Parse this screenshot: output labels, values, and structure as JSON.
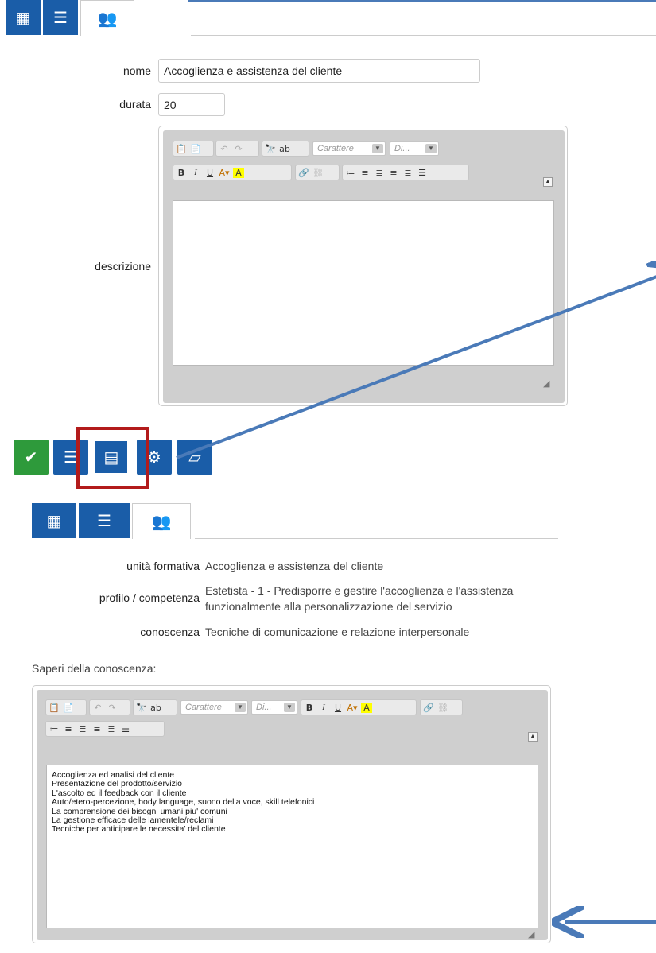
{
  "top": {
    "tabs": [
      {
        "icon": "calendar-icon",
        "glyph": "▦"
      },
      {
        "icon": "list-icon",
        "glyph": "☰"
      },
      {
        "icon": "users-icon",
        "glyph": "👥"
      }
    ],
    "form": {
      "name_label": "nome",
      "name_value": "Accoglienza e assistenza del cliente",
      "duration_label": "durata",
      "duration_value": "20",
      "description_label": "descrizione",
      "font_combo": "Carattere",
      "size_combo": "Di..."
    },
    "actions": [
      {
        "icon": "check-icon",
        "glyph": "✔"
      },
      {
        "icon": "list-icon",
        "glyph": "☰"
      },
      {
        "icon": "id-card-icon",
        "glyph": "▤"
      },
      {
        "icon": "gear-icon",
        "glyph": "⚙"
      },
      {
        "icon": "book-icon",
        "glyph": "▱"
      }
    ]
  },
  "bottom": {
    "info": {
      "unit_label": "unità formativa",
      "unit_value": "Accoglienza e assistenza del cliente",
      "profile_label": "profilo / competenza",
      "profile_value_line1": "Estetista - 1 - Predisporre e gestire l'accoglienza e l'assistenza",
      "profile_value_line2": "funzionalmente alla personalizzazione del servizio",
      "knowledge_label": "conoscenza",
      "knowledge_value": "Tecniche di comunicazione e relazione interpersonale"
    },
    "saperi_label": "Saperi della conoscenza:",
    "font_combo": "Carattere",
    "size_combo": "Di...",
    "content_lines": [
      "Accoglienza ed analisi del cliente",
      "Presentazione del prodotto/servizio",
      "L'ascolto ed il feedback con il cliente",
      "Auto/etero-percezione, body language, suono della voce, skill telefonici",
      "La comprensione dei bisogni umani piu' comuni",
      "La gestione efficace delle lamentele/reclami",
      "Tecniche per anticipare le necessita' del cliente"
    ]
  },
  "colors": {
    "accent": "#1a5da8",
    "success": "#2e9a3b",
    "highlight": "#b31b1b",
    "arrow": "#4a7ab8"
  }
}
